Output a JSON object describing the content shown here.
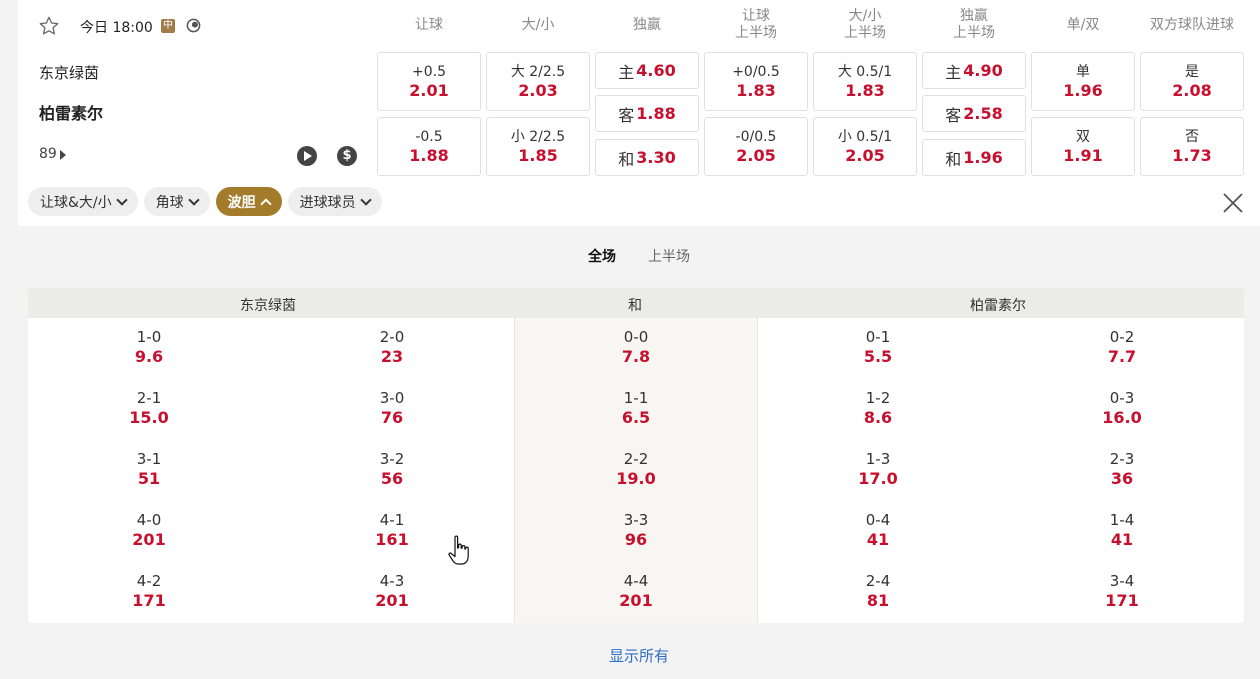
{
  "match": {
    "time": "今日 18:00",
    "badge": "中",
    "home": "东京绿茵",
    "away": "柏雷素尔",
    "minute": "89"
  },
  "markets": {
    "handicap": {
      "header": "让球",
      "home_line": "+0.5",
      "home_odd": "2.01",
      "away_line": "-0.5",
      "away_odd": "1.88"
    },
    "total": {
      "header": "大/小",
      "over_line": "大 2/2.5",
      "over_odd": "2.03",
      "under_line": "小 2/2.5",
      "under_odd": "1.85"
    },
    "winner": {
      "header": "独赢",
      "home_lbl": "主",
      "home_odd": "4.60",
      "away_lbl": "客",
      "away_odd": "1.88",
      "draw_lbl": "和",
      "draw_odd": "3.30"
    },
    "handicap_1h": {
      "header_l1": "让球",
      "header_l2": "上半场",
      "home_line": "+0/0.5",
      "home_odd": "1.83",
      "away_line": "-0/0.5",
      "away_odd": "2.05"
    },
    "total_1h": {
      "header_l1": "大/小",
      "header_l2": "上半场",
      "over_line": "大 0.5/1",
      "over_odd": "1.83",
      "under_line": "小 0.5/1",
      "under_odd": "2.05"
    },
    "winner_1h": {
      "header_l1": "独赢",
      "header_l2": "上半场",
      "home_lbl": "主",
      "home_odd": "4.90",
      "away_lbl": "客",
      "away_odd": "2.58",
      "draw_lbl": "和",
      "draw_odd": "1.96"
    },
    "odd_even": {
      "header": "单/双",
      "odd_lbl": "单",
      "odd_odd": "1.96",
      "even_lbl": "双",
      "even_odd": "1.91"
    },
    "btts": {
      "header": "双方球队进球",
      "yes_lbl": "是",
      "yes_odd": "2.08",
      "no_lbl": "否",
      "no_odd": "1.73"
    }
  },
  "filters": [
    {
      "label": "让球&大/小"
    },
    {
      "label": "角球"
    },
    {
      "label": "波胆"
    },
    {
      "label": "进球球员"
    }
  ],
  "period_tabs": [
    "全场",
    "上半场"
  ],
  "grid": {
    "home_header": "东京绿茵",
    "draw_header": "和",
    "away_header": "柏雷素尔",
    "rows": [
      [
        [
          "1-0",
          "9.6"
        ],
        [
          "2-0",
          "23"
        ],
        [
          "0-0",
          "7.8"
        ],
        [
          "0-1",
          "5.5"
        ],
        [
          "0-2",
          "7.7"
        ]
      ],
      [
        [
          "2-1",
          "15.0"
        ],
        [
          "3-0",
          "76"
        ],
        [
          "1-1",
          "6.5"
        ],
        [
          "1-2",
          "8.6"
        ],
        [
          "0-3",
          "16.0"
        ]
      ],
      [
        [
          "3-1",
          "51"
        ],
        [
          "3-2",
          "56"
        ],
        [
          "2-2",
          "19.0"
        ],
        [
          "1-3",
          "17.0"
        ],
        [
          "2-3",
          "36"
        ]
      ],
      [
        [
          "4-0",
          "201"
        ],
        [
          "4-1",
          "161"
        ],
        [
          "3-3",
          "96"
        ],
        [
          "0-4",
          "41"
        ],
        [
          "1-4",
          "41"
        ]
      ],
      [
        [
          "4-2",
          "171"
        ],
        [
          "4-3",
          "201"
        ],
        [
          "4-4",
          "201"
        ],
        [
          "2-4",
          "81"
        ],
        [
          "3-4",
          "171"
        ]
      ]
    ]
  },
  "show_all": "显示所有",
  "colors": {
    "odds": "#c8102e",
    "accent": "#a47b2a",
    "link": "#2e6dc7"
  }
}
